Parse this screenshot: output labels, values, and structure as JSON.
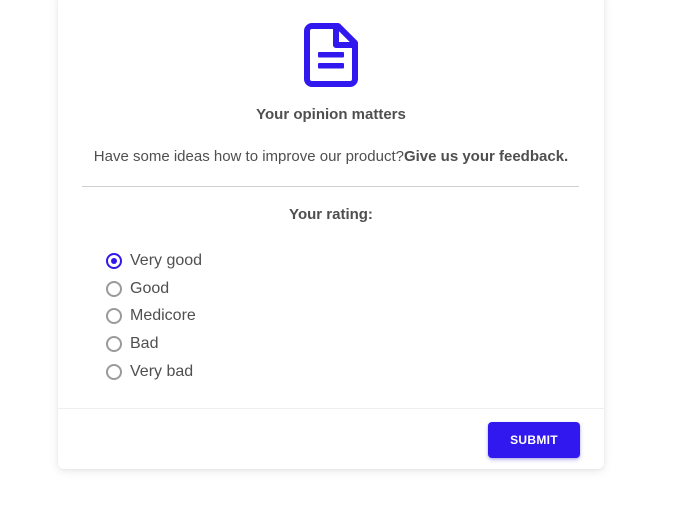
{
  "form": {
    "icon": "document-icon",
    "title": "Your opinion matters",
    "lead_text": "Have some ideas how to improve our product?",
    "lead_bold": "Give us your feedback.",
    "rating_label": "Your rating:",
    "options": [
      {
        "label": "Very good",
        "checked": true
      },
      {
        "label": "Good",
        "checked": false
      },
      {
        "label": "Medicore",
        "checked": false
      },
      {
        "label": "Bad",
        "checked": false
      },
      {
        "label": "Very bad",
        "checked": false
      }
    ],
    "submit_label": "SUBMIT"
  },
  "colors": {
    "accent": "#3118ee",
    "text": "#4f4f4f",
    "radio_unchecked": "#9a9a9a"
  }
}
